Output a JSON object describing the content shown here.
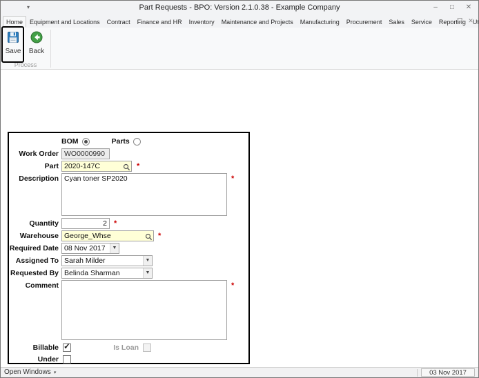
{
  "window": {
    "title": "Part Requests - BPO: Version 2.1.0.38 - Example Company"
  },
  "icons": {
    "qat_caret": "▾",
    "minimize": "–",
    "maximize": "□",
    "close": "✕",
    "child_minimize": "–",
    "child_restore": "❐",
    "child_close": "✕",
    "combo_arrow": "▼",
    "check": "✓",
    "open_windows_caret": "▾"
  },
  "ribbon": {
    "tabs": [
      "Home",
      "Equipment and Locations",
      "Contract",
      "Finance and HR",
      "Inventory",
      "Maintenance and Projects",
      "Manufacturing",
      "Procurement",
      "Sales",
      "Service",
      "Reporting",
      "Utilities"
    ],
    "active_tab": "Home",
    "save_label": "Save",
    "back_label": "Back",
    "group_label": "Process"
  },
  "form": {
    "bom_label": "BOM",
    "parts_label": "Parts",
    "bom_selected": true,
    "parts_selected": false,
    "required_marker": "*",
    "work_order": {
      "label": "Work Order",
      "value": "WO0000990"
    },
    "part": {
      "label": "Part",
      "value": "2020-147C",
      "required": true
    },
    "description": {
      "label": "Description",
      "value": "Cyan toner SP2020",
      "required": true
    },
    "quantity": {
      "label": "Quantity",
      "value": "2",
      "required": true
    },
    "warehouse": {
      "label": "Warehouse",
      "value": "George_Whse",
      "required": true
    },
    "required_date": {
      "label": "Required Date",
      "value": "08 Nov 2017"
    },
    "assigned_to": {
      "label": "Assigned To",
      "value": "Sarah Milder"
    },
    "requested_by": {
      "label": "Requested By",
      "value": "Belinda Sharman"
    },
    "comment": {
      "label": "Comment",
      "value": "",
      "required": true
    },
    "billable": {
      "label": "Billable",
      "checked": true
    },
    "is_loan": {
      "label": "Is Loan",
      "checked": false,
      "enabled": false
    },
    "under_warranty": {
      "label": "Under Warranty",
      "checked": false
    }
  },
  "statusbar": {
    "open_windows_label": "Open Windows",
    "date": "03 Nov 2017"
  },
  "colors": {
    "lookup_field_bg": "#ffffd7",
    "readonly_field_bg": "#ececec",
    "required_red": "#cc0000",
    "save_icon_blue": "#2d7dbd",
    "back_icon_green": "#43a047"
  }
}
